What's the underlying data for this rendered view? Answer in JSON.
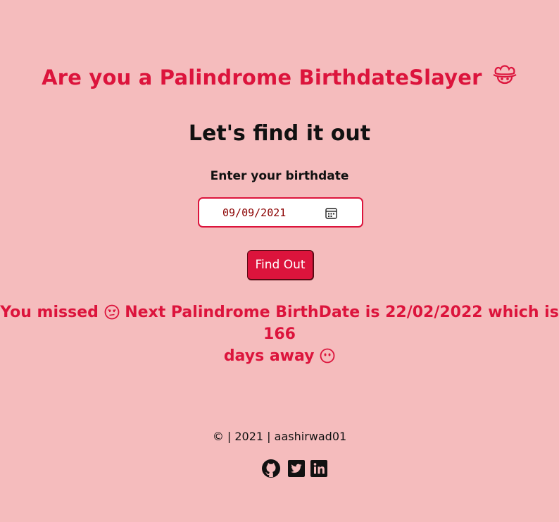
{
  "header": {
    "title": "Are you a Palindrome BirthdateSlayer",
    "title_emoji": "cowboy-face",
    "subtitle": "Let's find it out"
  },
  "form": {
    "label": "Enter your birthdate",
    "date_value": "09/09/2021",
    "button_label": "Find Out"
  },
  "result": {
    "part1": "You missed",
    "part2": "Next Palindrome BirthDate is 22/02/2022 which is 166",
    "part3": "days away",
    "emoji1": "unamused-face",
    "emoji2": "face-without-mouth"
  },
  "footer": {
    "text": "© | 2021 | aashirwad01",
    "links": [
      "github-icon",
      "twitter-icon",
      "linkedin-icon"
    ]
  },
  "colors": {
    "background": "#f5bcbd",
    "accent": "#dc143c"
  }
}
